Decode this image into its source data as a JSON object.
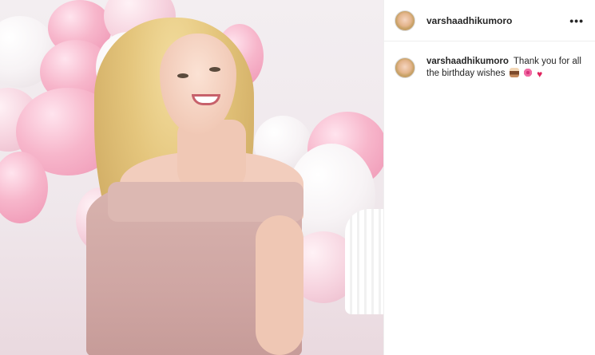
{
  "post": {
    "username": "varshaadhikumoro",
    "more_icon": "more-dots-icon",
    "caption": {
      "author": "varshaadhikumoro",
      "text": "Thank you for all the birthday wishes",
      "emojis": [
        "cake-emoji",
        "ribbon-emoji",
        "heart-emoji"
      ]
    }
  },
  "colors": {
    "text": "#262626",
    "divider": "#efefef",
    "dress": "#cfa6a3",
    "balloon_pink": "#f7b6cb",
    "heart": "#e0245e"
  }
}
